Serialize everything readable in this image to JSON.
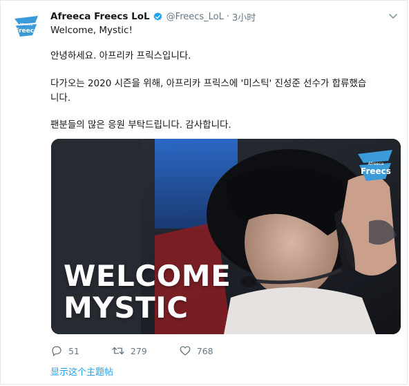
{
  "tweet": {
    "author_name": "Afreeca Freecs LoL",
    "handle": "@Freecs_LoL",
    "separator": "·",
    "time": "3小时",
    "lines": [
      "Welcome, Mystic!",
      "안녕하세요. 아프리카 프릭스입니다.",
      "다가오는 2020 시즌을 위해, 아프리카 프릭스에 '미스틱' 진성준 선수가 합류했습",
      "니다.",
      "팬분들의 많은 응원 부탁드립니다. 감사합니다."
    ],
    "media": {
      "title_line1": "WELCOME",
      "title_line2": "MYSTIC",
      "logo_small_text": "Afreeca",
      "logo_text": "Freecs"
    },
    "actions": {
      "reply_count": "51",
      "retweet_count": "279",
      "like_count": "768"
    },
    "show_thread": "显示这个主题帖",
    "avatar_logo_text": "Freecs",
    "avatar_logo_small_text": "Afreeca"
  },
  "colors": {
    "brand_blue": "#1da1f2",
    "text": "#14171a",
    "muted": "#657786",
    "freecs_blue": "#3a9bd8"
  },
  "icons": [
    "verified-icon",
    "chevron-down-icon",
    "reply-icon",
    "retweet-icon",
    "like-icon",
    "freecs-logo"
  ]
}
